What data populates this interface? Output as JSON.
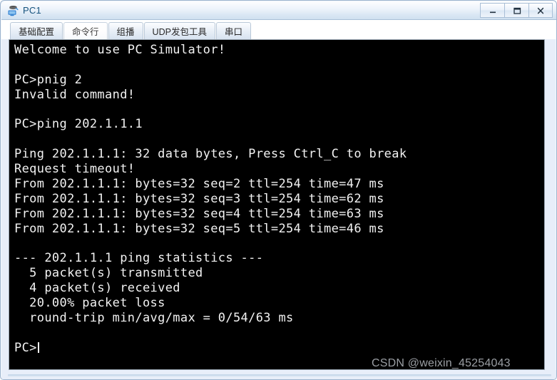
{
  "window": {
    "title": "PC1",
    "icon": "pc-host-icon",
    "controls": [
      {
        "name": "minimize-button",
        "glyph": "_",
        "label": "Minimize"
      },
      {
        "name": "maximize-button",
        "glyph": "□",
        "label": "Maximize"
      },
      {
        "name": "close-button",
        "glyph": "X",
        "label": "Close"
      }
    ]
  },
  "tabs": [
    {
      "label": "基础配置",
      "active": false
    },
    {
      "label": "命令行",
      "active": true
    },
    {
      "label": "组播",
      "active": false
    },
    {
      "label": "UDP发包工具",
      "active": false
    },
    {
      "label": "串口",
      "active": false
    }
  ],
  "terminal": {
    "background": "#000000",
    "foreground": "#f2f2f2",
    "prompt": "PC>",
    "cursor_visible": true,
    "lines": [
      "Welcome to use PC Simulator!",
      "",
      "PC>pnig 2",
      "Invalid command!",
      "",
      "PC>ping 202.1.1.1",
      "",
      "Ping 202.1.1.1: 32 data bytes, Press Ctrl_C to break",
      "Request timeout!",
      "From 202.1.1.1: bytes=32 seq=2 ttl=254 time=47 ms",
      "From 202.1.1.1: bytes=32 seq=3 ttl=254 time=62 ms",
      "From 202.1.1.1: bytes=32 seq=4 ttl=254 time=63 ms",
      "From 202.1.1.1: bytes=32 seq=5 ttl=254 time=46 ms",
      "",
      "--- 202.1.1.1 ping statistics ---",
      "  5 packet(s) transmitted",
      "  4 packet(s) received",
      "  20.00% packet loss",
      "  round-trip min/avg/max = 0/54/63 ms",
      ""
    ]
  },
  "watermark": {
    "text": "CSDN @weixin_45254043"
  }
}
